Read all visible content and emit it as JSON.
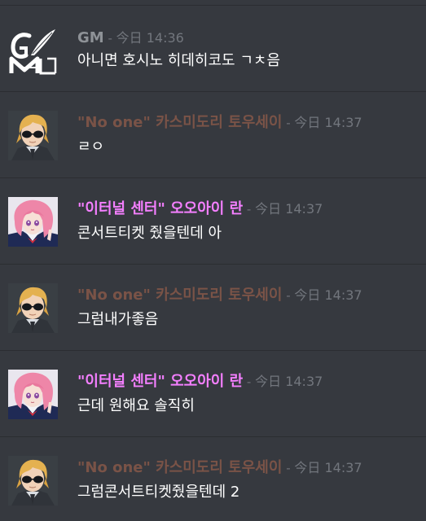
{
  "messages": [
    {
      "author": "GM",
      "author_color": "#8e9297",
      "avatar": "gm-logo-icon",
      "separator": " - ",
      "timestamp": "今日 14:36",
      "content": "아니면 호시노 히데히코도 ㄱㅊ음"
    },
    {
      "author": "\"No one\" 카스미도리 토우세이",
      "author_color": "#7a5347",
      "avatar": "blond-glasses-avatar",
      "separator": " - ",
      "timestamp": "今日 14:37",
      "content": "ㄹㅇ"
    },
    {
      "author": "\"이터널 센터\" 오오아이 란",
      "author_color": "#f47fff",
      "avatar": "pink-hair-avatar",
      "separator": " - ",
      "timestamp": "今日 14:37",
      "content": "콘서트티켓 줬을텐데 아"
    },
    {
      "author": "\"No one\" 카스미도리 토우세이",
      "author_color": "#7a5347",
      "avatar": "blond-glasses-avatar",
      "separator": " - ",
      "timestamp": "今日 14:37",
      "content": "그럼내가좋음"
    },
    {
      "author": "\"이터널 센터\" 오오아이 란",
      "author_color": "#f47fff",
      "avatar": "pink-hair-avatar",
      "separator": " - ",
      "timestamp": "今日 14:37",
      "content": "근데 원해요 솔직히"
    },
    {
      "author": "\"No one\" 카스미도리 토우세이",
      "author_color": "#7a5347",
      "avatar": "blond-glasses-avatar",
      "separator": " - ",
      "timestamp": "今日 14:37",
      "content": "그럼콘서트티켓줬을텐데 2"
    }
  ]
}
